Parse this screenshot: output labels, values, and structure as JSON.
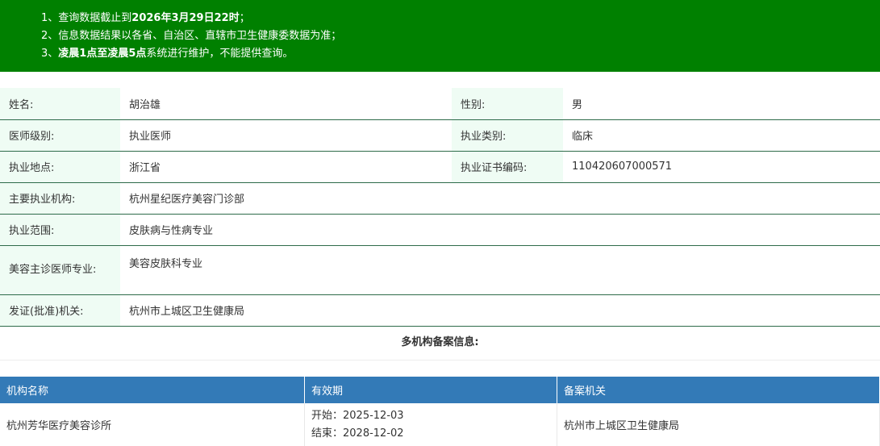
{
  "notice": {
    "line1_prefix": "1、查询数据截止到",
    "line1_bold": "2026年3月29日22时",
    "line1_suffix": "；",
    "line2_prefix": "2、",
    "line2_text": "信息数据结果以各省、自治区、直辖市卫生健康委数据为准；",
    "line3_prefix": "3、",
    "line3_bold": "凌晨1点至凌晨5点",
    "line3_suffix": "系统进行维护，不能提供查询。"
  },
  "info": {
    "name_label": "姓名:",
    "name": "胡治雄",
    "gender_label": "性别:",
    "gender": "男",
    "level_label": "医师级别:",
    "level": "执业医师",
    "category_label": "执业类别:",
    "category": "临床",
    "location_label": "执业地点:",
    "location": "浙江省",
    "cert_label": "执业证书编码:",
    "cert": "110420607000571",
    "org_label": "主要执业机构:",
    "org": "杭州星纪医疗美容门诊部",
    "scope_label": "执业范围:",
    "scope": "皮肤病与性病专业",
    "cosmetic_label": "美容主诊医师专业:",
    "cosmetic": "美容皮肤科专业",
    "issuer_label": "发证(批准)机关:",
    "issuer": "杭州市上城区卫生健康局"
  },
  "multi_title": "多机构备案信息:",
  "registrations": {
    "headers": [
      "机构名称",
      "有效期",
      "备案机关"
    ],
    "rows": [
      {
        "org": "杭州芳华医疗美容诊所",
        "start": "开始：2025-12-03",
        "end": "结束：2028-12-02",
        "authority": "杭州市上城区卫生健康局"
      }
    ]
  }
}
